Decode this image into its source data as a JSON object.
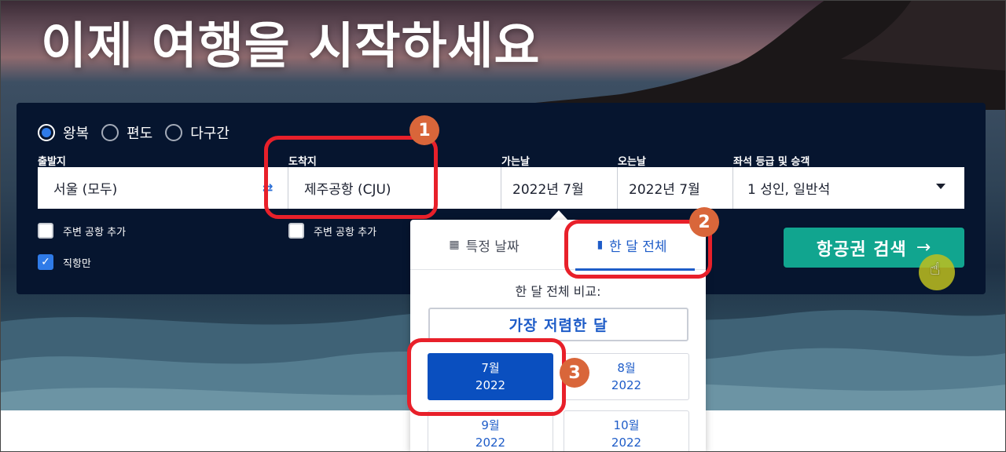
{
  "hero": {
    "title": "이제 여행을 시작하세요"
  },
  "trip_types": [
    {
      "label": "왕복",
      "selected": true
    },
    {
      "label": "편도",
      "selected": false
    },
    {
      "label": "다구간",
      "selected": false
    }
  ],
  "form": {
    "origin": {
      "label": "출발지",
      "value": "서울 (모두)"
    },
    "destination": {
      "label": "도착지",
      "value": "제주공항 (CJU)"
    },
    "depart": {
      "label": "가는날",
      "value": "2022년 7월"
    },
    "return": {
      "label": "오는날",
      "value": "2022년 7월"
    },
    "cabin": {
      "label": "좌석 등급 및 승객",
      "value": "1 성인, 일반석"
    }
  },
  "options": {
    "nearby_origin": {
      "label": "주변 공항 추가",
      "checked": false
    },
    "nearby_destination": {
      "label": "주변 공항 추가",
      "checked": false
    },
    "direct_only": {
      "label": "직항만",
      "checked": true
    }
  },
  "search_button": {
    "label": "항공권 검색",
    "arrow": "→"
  },
  "date_popup": {
    "tabs": [
      {
        "label": "특정 날짜",
        "icon": "calendar-icon",
        "active": false
      },
      {
        "label": "한 달 전체",
        "icon": "bar-chart-icon",
        "active": true
      }
    ],
    "compare_label": "한 달 전체 비교:",
    "cheapest_label": "가장 저렴한 달",
    "months": [
      {
        "month": "7월",
        "year": "2022",
        "selected": true
      },
      {
        "month": "8월",
        "year": "2022",
        "selected": false
      },
      {
        "month": "9월",
        "year": "2022",
        "selected": false
      },
      {
        "month": "10월",
        "year": "2022",
        "selected": false
      }
    ]
  },
  "annotations": [
    "1",
    "2",
    "3"
  ],
  "colors": {
    "panel": "#06152f",
    "accent_blue": "#1e5cc8",
    "search_green": "#11a58f",
    "callout_red": "#e8202a",
    "badge_orange": "#d9663a"
  }
}
